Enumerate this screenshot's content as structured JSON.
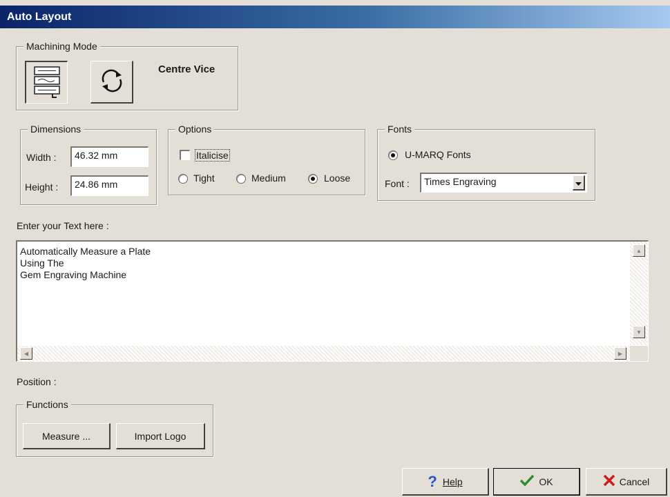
{
  "window": {
    "title": "Auto Layout"
  },
  "machining_mode": {
    "legend": "Machining Mode",
    "buttons": [
      {
        "icon": "fixture-icon",
        "pressed": true
      },
      {
        "icon": "rotate-icon",
        "pressed": false
      }
    ],
    "mode_label": "Centre Vice"
  },
  "dimensions": {
    "legend": "Dimensions",
    "width_label": "Width :",
    "width_value": "46.32 mm",
    "height_label": "Height :",
    "height_value": "24.86 mm"
  },
  "options": {
    "legend": "Options",
    "italicise_label": "Italicise",
    "italicise_checked": false,
    "spacing": [
      {
        "label": "Tight",
        "checked": false
      },
      {
        "label": "Medium",
        "checked": false
      },
      {
        "label": "Loose",
        "checked": true
      }
    ]
  },
  "fonts": {
    "legend": "Fonts",
    "umarq_label": "U-MARQ Fonts",
    "umarq_checked": true,
    "font_label": "Font :",
    "font_value": "Times Engraving"
  },
  "text_entry": {
    "label": "Enter your Text here :",
    "lines": [
      "Automatically Measure a Plate",
      "Using The",
      "Gem Engraving Machine"
    ]
  },
  "position": {
    "label": "Position :"
  },
  "functions": {
    "legend": "Functions",
    "measure_label": "Measure ...",
    "import_logo_label": "Import Logo"
  },
  "footer": {
    "help_label": "Help",
    "ok_label": "OK",
    "cancel_label": "Cancel"
  },
  "colors": {
    "dialog_bg": "#e3ded6",
    "title_start": "#0a246a",
    "title_end": "#a6caf0",
    "help_icon": "#2a56c6",
    "ok_icon": "#2e8b2e",
    "cancel_icon": "#c81e1e"
  }
}
